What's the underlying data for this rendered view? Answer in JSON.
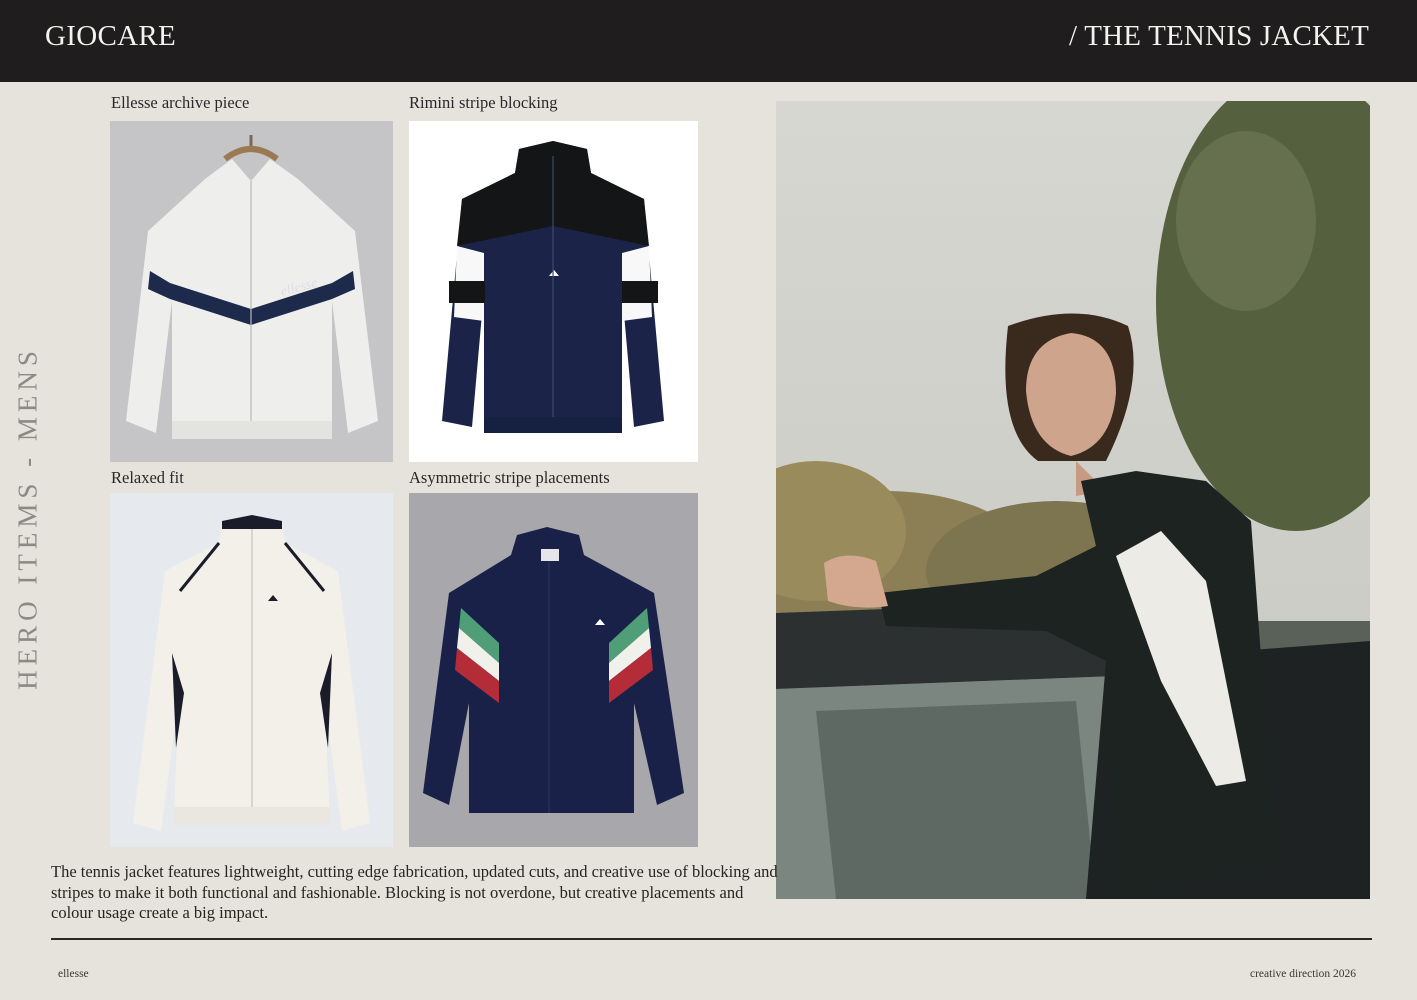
{
  "header": {
    "brand": "GIOCARE",
    "section_title": "/ THE TENNIS JACKET"
  },
  "side_label": "HERO ITEMS - MENS",
  "gallery": [
    {
      "caption": "Ellesse archive piece",
      "image": "white-jacket-navy-chevron-on-hanger"
    },
    {
      "caption": "Rimini stripe blocking",
      "image": "navy-black-white-blocked-jacket"
    },
    {
      "caption": "Relaxed fit",
      "image": "cream-jacket-navy-piping"
    },
    {
      "caption": "Asymmetric stripe placements",
      "image": "navy-jacket-green-white-red-stripes"
    }
  ],
  "hero_image": "model-in-black-white-jacket-leaning-on-car",
  "logo_text": "ellesse",
  "description": "The tennis jacket features lightweight, cutting edge fabrication, updated cuts, and creative use of blocking and stripes to make it both functional and fashionable. Blocking is not overdone, but creative placements and colour usage create a big impact.",
  "footer": {
    "left": "ellesse",
    "right": "creative direction 2026"
  },
  "colors": {
    "background": "#e5e3dc",
    "header_bg": "#1f1d1e",
    "header_text": "#f4f2ee",
    "side_label": "#8d8a86",
    "navy": "#1d2a4c"
  }
}
